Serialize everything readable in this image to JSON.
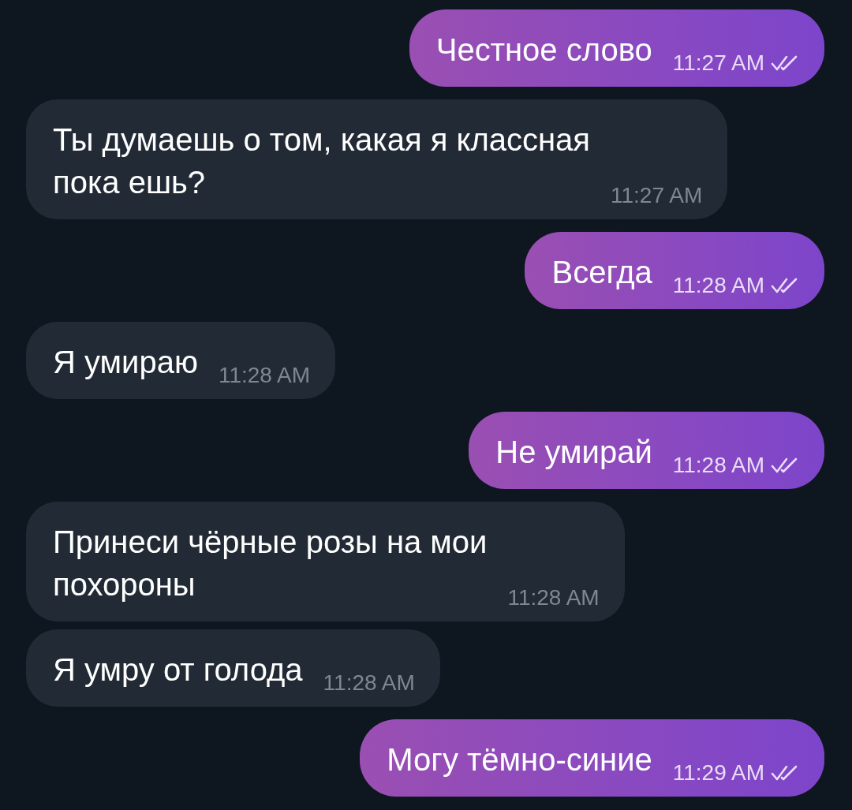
{
  "messages": [
    {
      "kind": "outgoing",
      "text": "Честное слово",
      "time": "11:27 AM",
      "read": true
    },
    {
      "kind": "incoming",
      "text": "Ты думаешь о том, какая я классная\nпока ешь?",
      "time": "11:27 AM"
    },
    {
      "kind": "outgoing",
      "text": "Всегда",
      "time": "11:28 AM",
      "read": true
    },
    {
      "kind": "incoming",
      "text": "Я умираю",
      "time": "11:28 AM"
    },
    {
      "kind": "outgoing",
      "text": "Не умирай",
      "time": "11:28 AM",
      "read": true
    },
    {
      "kind": "incoming",
      "text": "Принеси чёрные розы на мои\nпохороны",
      "time": "11:28 AM"
    },
    {
      "kind": "incoming",
      "text": "Я умру от голода",
      "time": "11:28 AM"
    },
    {
      "kind": "outgoing",
      "text": "Могу тёмно-синие",
      "time": "11:29 AM",
      "read": true
    }
  ]
}
